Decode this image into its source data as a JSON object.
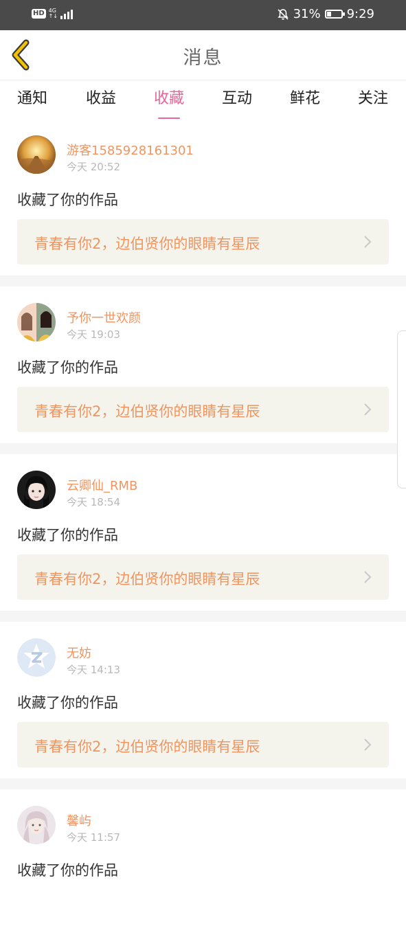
{
  "status_bar": {
    "hd": "HD",
    "network_top": "4G",
    "network_bottom": "↑↓",
    "battery_percent": "31%",
    "battery_level": 0.31,
    "time": "9:29",
    "icons": [
      "bell-off-icon",
      "battery-icon",
      "signal-icon"
    ]
  },
  "header": {
    "title": "消息",
    "back_icon": "chevron-left-icon",
    "back_color": "#f2c200"
  },
  "tabs": {
    "items": [
      "通知",
      "收益",
      "收藏",
      "互动",
      "鲜花",
      "关注"
    ],
    "active_index": 2,
    "active_color": "#e5679a"
  },
  "feed": [
    {
      "username": "游客1585928161301",
      "time": "今天 20:52",
      "action": "收藏了你的作品",
      "work_title": "青春有你2，边伯贤你的眼睛有星辰"
    },
    {
      "username": "予你一世欢颜",
      "time": "今天 19:03",
      "action": "收藏了你的作品",
      "work_title": "青春有你2，边伯贤你的眼睛有星辰"
    },
    {
      "username": "云卿仙_RMB",
      "time": "今天 18:54",
      "action": "收藏了你的作品",
      "work_title": "青春有你2，边伯贤你的眼睛有星辰"
    },
    {
      "username": "无妨",
      "time": "今天 14:13",
      "action": "收藏了你的作品",
      "work_title": "青春有你2，边伯贤你的眼睛有星辰"
    },
    {
      "username": "馨屿",
      "time": "今天 11:57",
      "action": "收藏了你的作品",
      "work_title": ""
    }
  ],
  "colors": {
    "accent_orange": "#f0955f",
    "work_box_bg": "#f4f3ec",
    "status_bar_bg": "#4a4a4a"
  }
}
